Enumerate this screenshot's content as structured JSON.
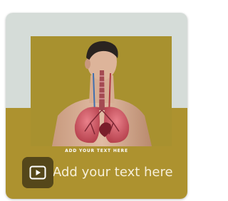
{
  "template": {
    "heading_text": "Add your text here",
    "body_text": "ADD YOUR TEXT HERE"
  },
  "icons": {
    "video_badge": "video-play-icon"
  },
  "colors": {
    "card_top": "#d5dcd8",
    "card_bottom": "#ad922f",
    "photo_background": "#a8912f",
    "heading_text": "#f6efda"
  }
}
